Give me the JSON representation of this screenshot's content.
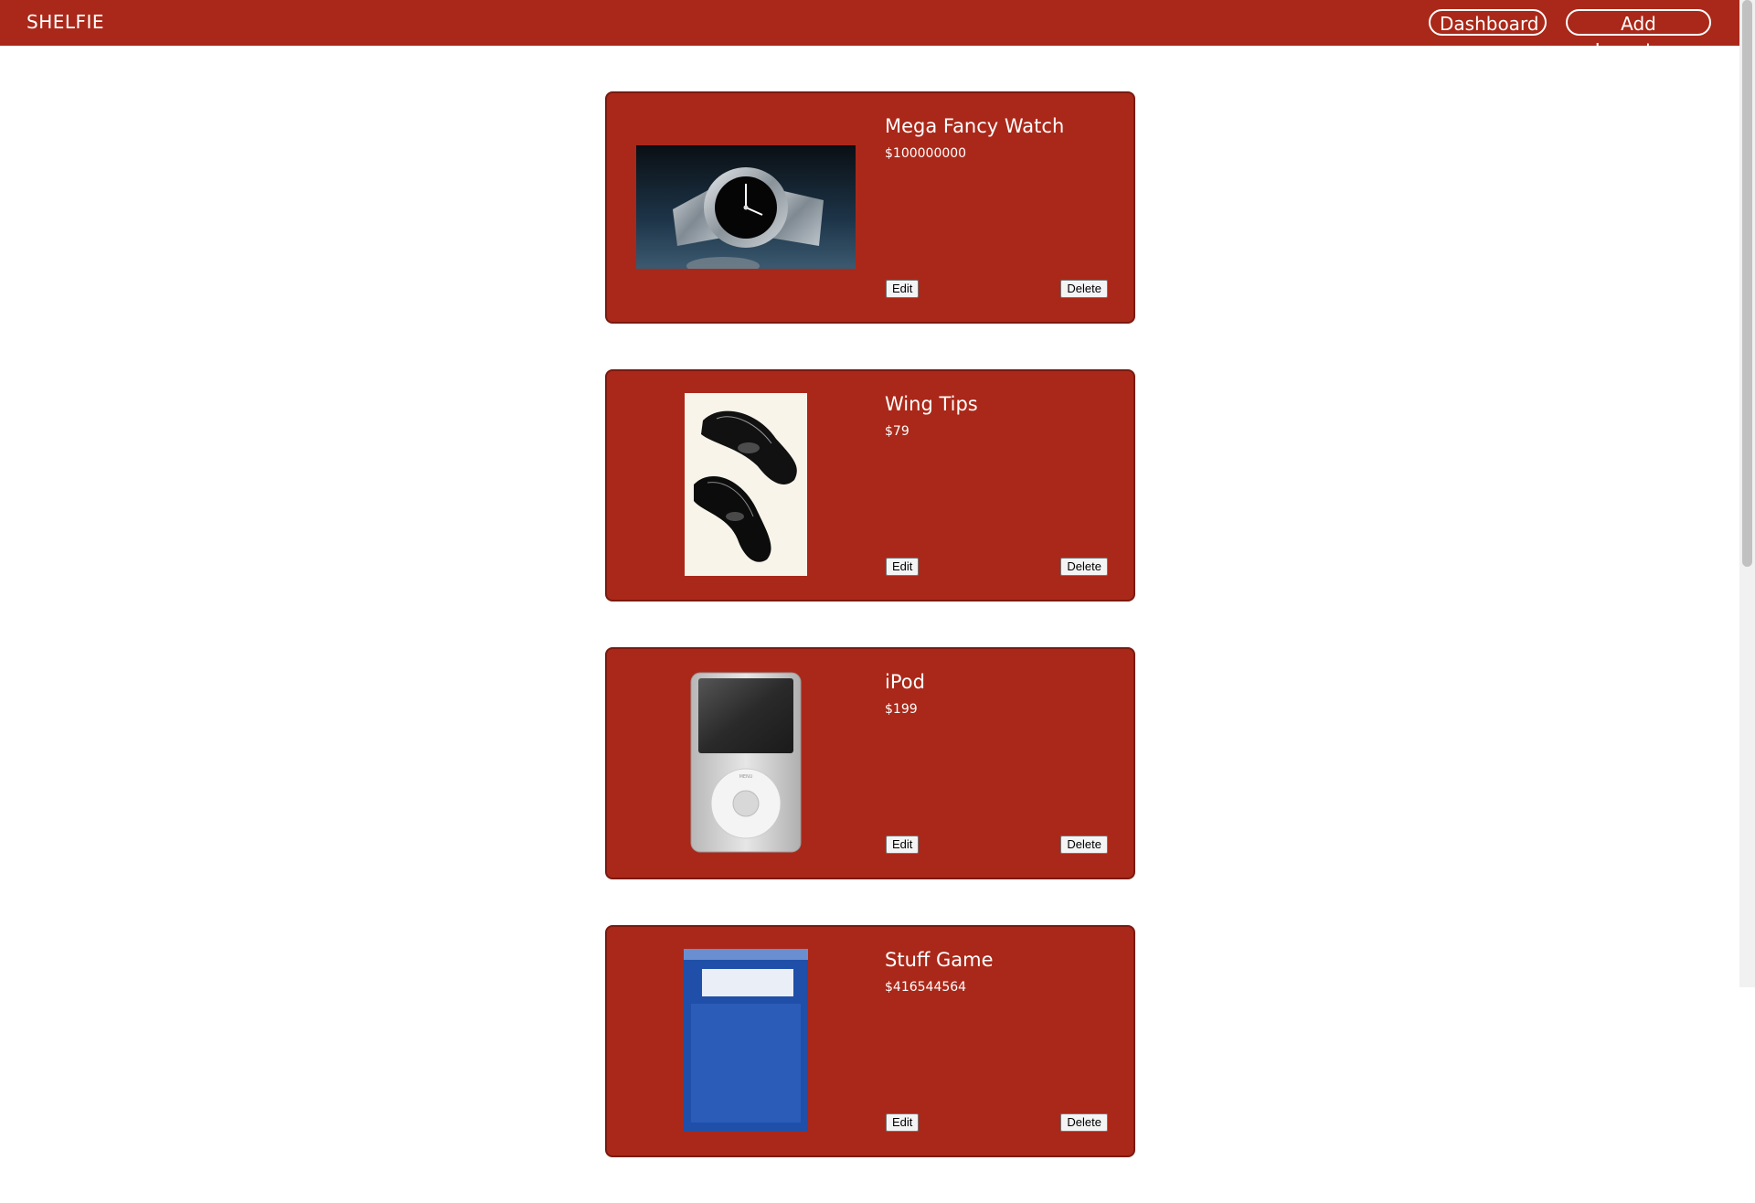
{
  "header": {
    "brand": "SHELFIE",
    "nav": {
      "dashboard": "Dashboard",
      "add_inventory": "Add Inventory"
    }
  },
  "products": [
    {
      "name": "Mega Fancy Watch",
      "price": "$100000000",
      "image": "watch-image",
      "edit": "Edit",
      "delete": "Delete"
    },
    {
      "name": "Wing Tips",
      "price": "$79",
      "image": "shoes-image",
      "edit": "Edit",
      "delete": "Delete"
    },
    {
      "name": "iPod",
      "price": "$199",
      "image": "ipod-image",
      "edit": "Edit",
      "delete": "Delete"
    },
    {
      "name": "Stuff Game",
      "price": "$416544564",
      "image": "game-box-image",
      "edit": "Edit",
      "delete": "Delete"
    }
  ],
  "colors": {
    "accent": "#aa2819",
    "card_border": "#7a1a10"
  }
}
